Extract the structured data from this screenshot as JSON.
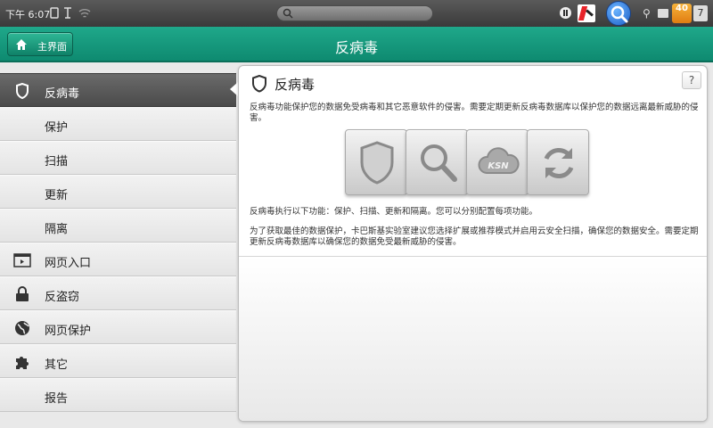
{
  "status_bar": {
    "time": "下午 6:07",
    "warning_badge": "40",
    "notification_count": "7"
  },
  "header": {
    "home_label": "主界面",
    "title": "反病毒"
  },
  "sidebar": {
    "items": [
      {
        "label": "反病毒",
        "icon": "shield-icon",
        "active": true
      },
      {
        "label": "保护",
        "icon": ""
      },
      {
        "label": "扫描",
        "icon": ""
      },
      {
        "label": "更新",
        "icon": ""
      },
      {
        "label": "隔离",
        "icon": ""
      },
      {
        "label": "网页入口",
        "icon": "browser-icon"
      },
      {
        "label": "反盗窃",
        "icon": "lock-icon"
      },
      {
        "label": "网页保护",
        "icon": "globe-icon"
      },
      {
        "label": "其它",
        "icon": "puzzle-icon"
      },
      {
        "label": "报告",
        "icon": ""
      }
    ]
  },
  "panel": {
    "title": "反病毒",
    "help": "?",
    "intro": "反病毒功能保护您的数据免受病毒和其它恶意软件的侵害。需要定期更新反病毒数据库以保护您的数据远离最新威胁的侵害。",
    "functions": "反病毒执行以下功能：保护、扫描、更新和隔离。您可以分别配置每项功能。",
    "advice": "为了获取最佳的数据保护，卡巴斯基实验室建议您选择扩展或推荐模式并启用云安全扫描，确保您的数据安全。需要定期更新反病毒数据库以确保您的数据免受最新威胁的侵害。",
    "tiles": [
      {
        "icon": "shield-icon"
      },
      {
        "icon": "magnifier-icon"
      },
      {
        "icon": "cloud-icon",
        "label": "KSN"
      },
      {
        "icon": "refresh-icon"
      }
    ]
  },
  "colors": {
    "header_green": "#1fa88a",
    "active_item": "#555555"
  }
}
